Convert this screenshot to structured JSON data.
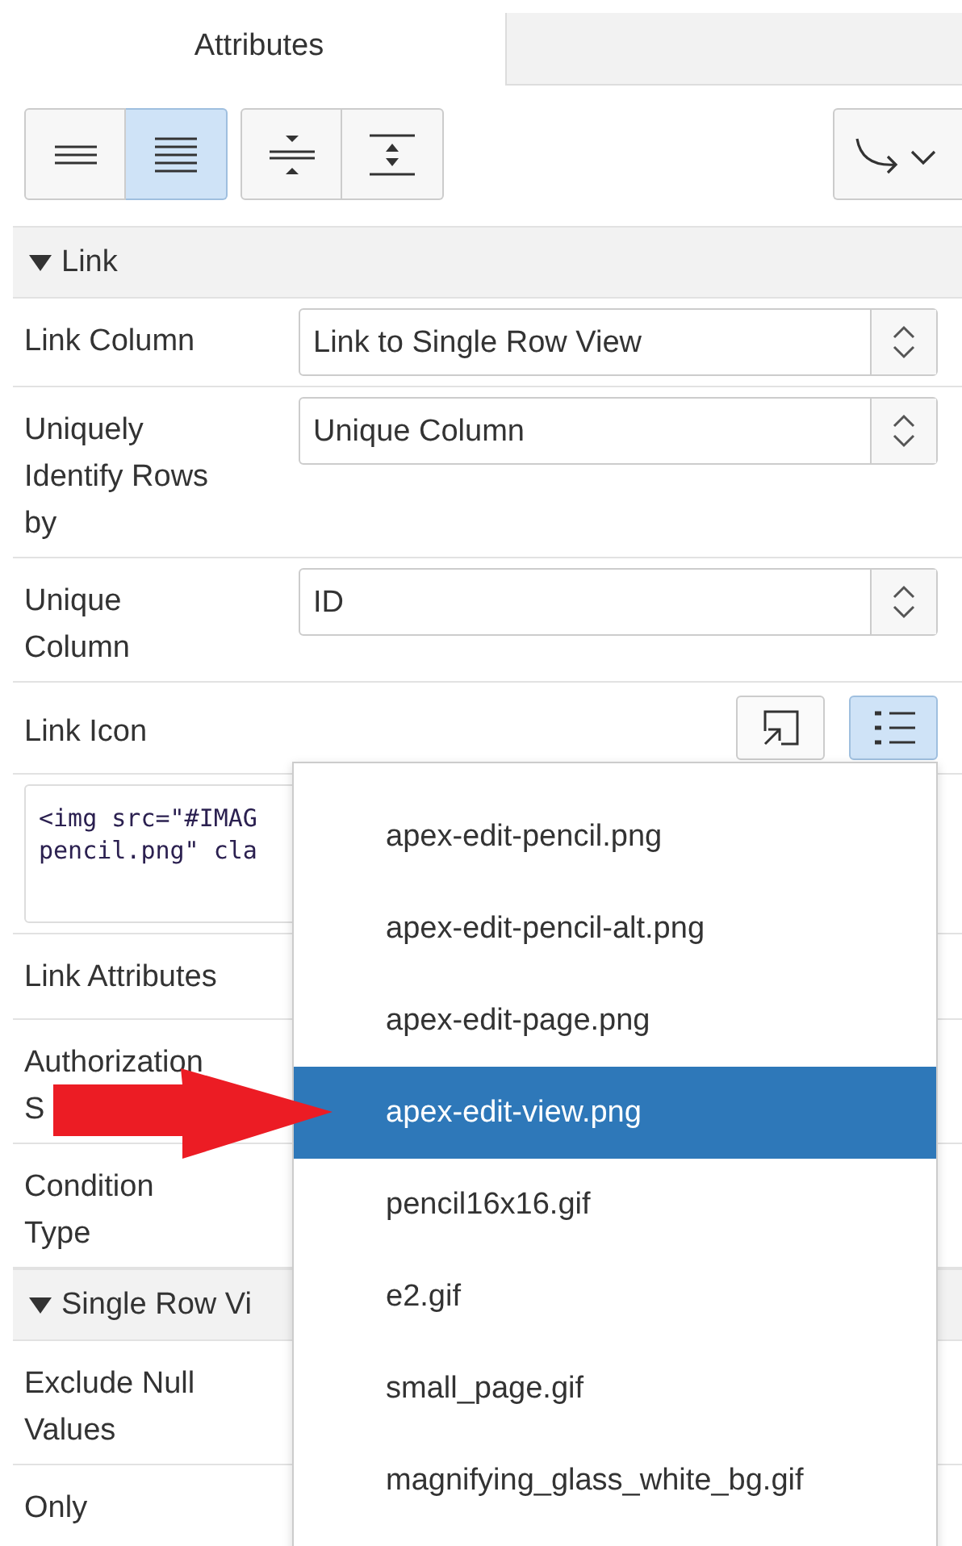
{
  "tabs": [
    {
      "label": "Attributes",
      "selected": true
    }
  ],
  "toolbar": {
    "groups": [
      [
        {
          "kind": "lines-sparse",
          "selected": false
        },
        {
          "kind": "lines-dense",
          "selected": true
        }
      ],
      [
        {
          "kind": "collapse",
          "selected": false
        },
        {
          "kind": "expand",
          "selected": false
        }
      ]
    ]
  },
  "sections": [
    {
      "title": "Link",
      "expanded": true,
      "rows": [
        {
          "kind": "select",
          "label": "Link Column",
          "value": "Link to Single Row View"
        },
        {
          "kind": "select",
          "label": "Uniquely Identify Rows by",
          "value": "Unique Column"
        },
        {
          "kind": "select",
          "label": "Unique Column",
          "value": "ID"
        },
        {
          "kind": "icon-picker",
          "label": "Link Icon",
          "buttons": [
            {
              "kind": "popup",
              "selected": false
            },
            {
              "kind": "list",
              "selected": true
            }
          ]
        },
        {
          "kind": "code",
          "lines": [
            "<img src=\"#IMAG",
            "pencil.png\" cla"
          ]
        },
        {
          "kind": "text",
          "label": "Link Attributes"
        },
        {
          "kind": "text",
          "label": "Authorization S"
        },
        {
          "kind": "text",
          "label": "Condition Type"
        }
      ]
    },
    {
      "title": "Single Row Vi",
      "expanded": true,
      "rows": [
        {
          "kind": "text",
          "label": "Exclude Null Values"
        },
        {
          "kind": "text",
          "label": "Only"
        }
      ]
    }
  ],
  "popup": {
    "items": [
      {
        "label": "apex-edit-pencil.png",
        "selected": false
      },
      {
        "label": "apex-edit-pencil-alt.png",
        "selected": false
      },
      {
        "label": "apex-edit-page.png",
        "selected": false
      },
      {
        "label": "apex-edit-view.png",
        "selected": true
      },
      {
        "label": "pencil16x16.gif",
        "selected": false
      },
      {
        "label": "e2.gif",
        "selected": false
      },
      {
        "label": "small_page.gif",
        "selected": false
      },
      {
        "label": "magnifying_glass_white_bg.gif",
        "selected": false
      }
    ]
  }
}
